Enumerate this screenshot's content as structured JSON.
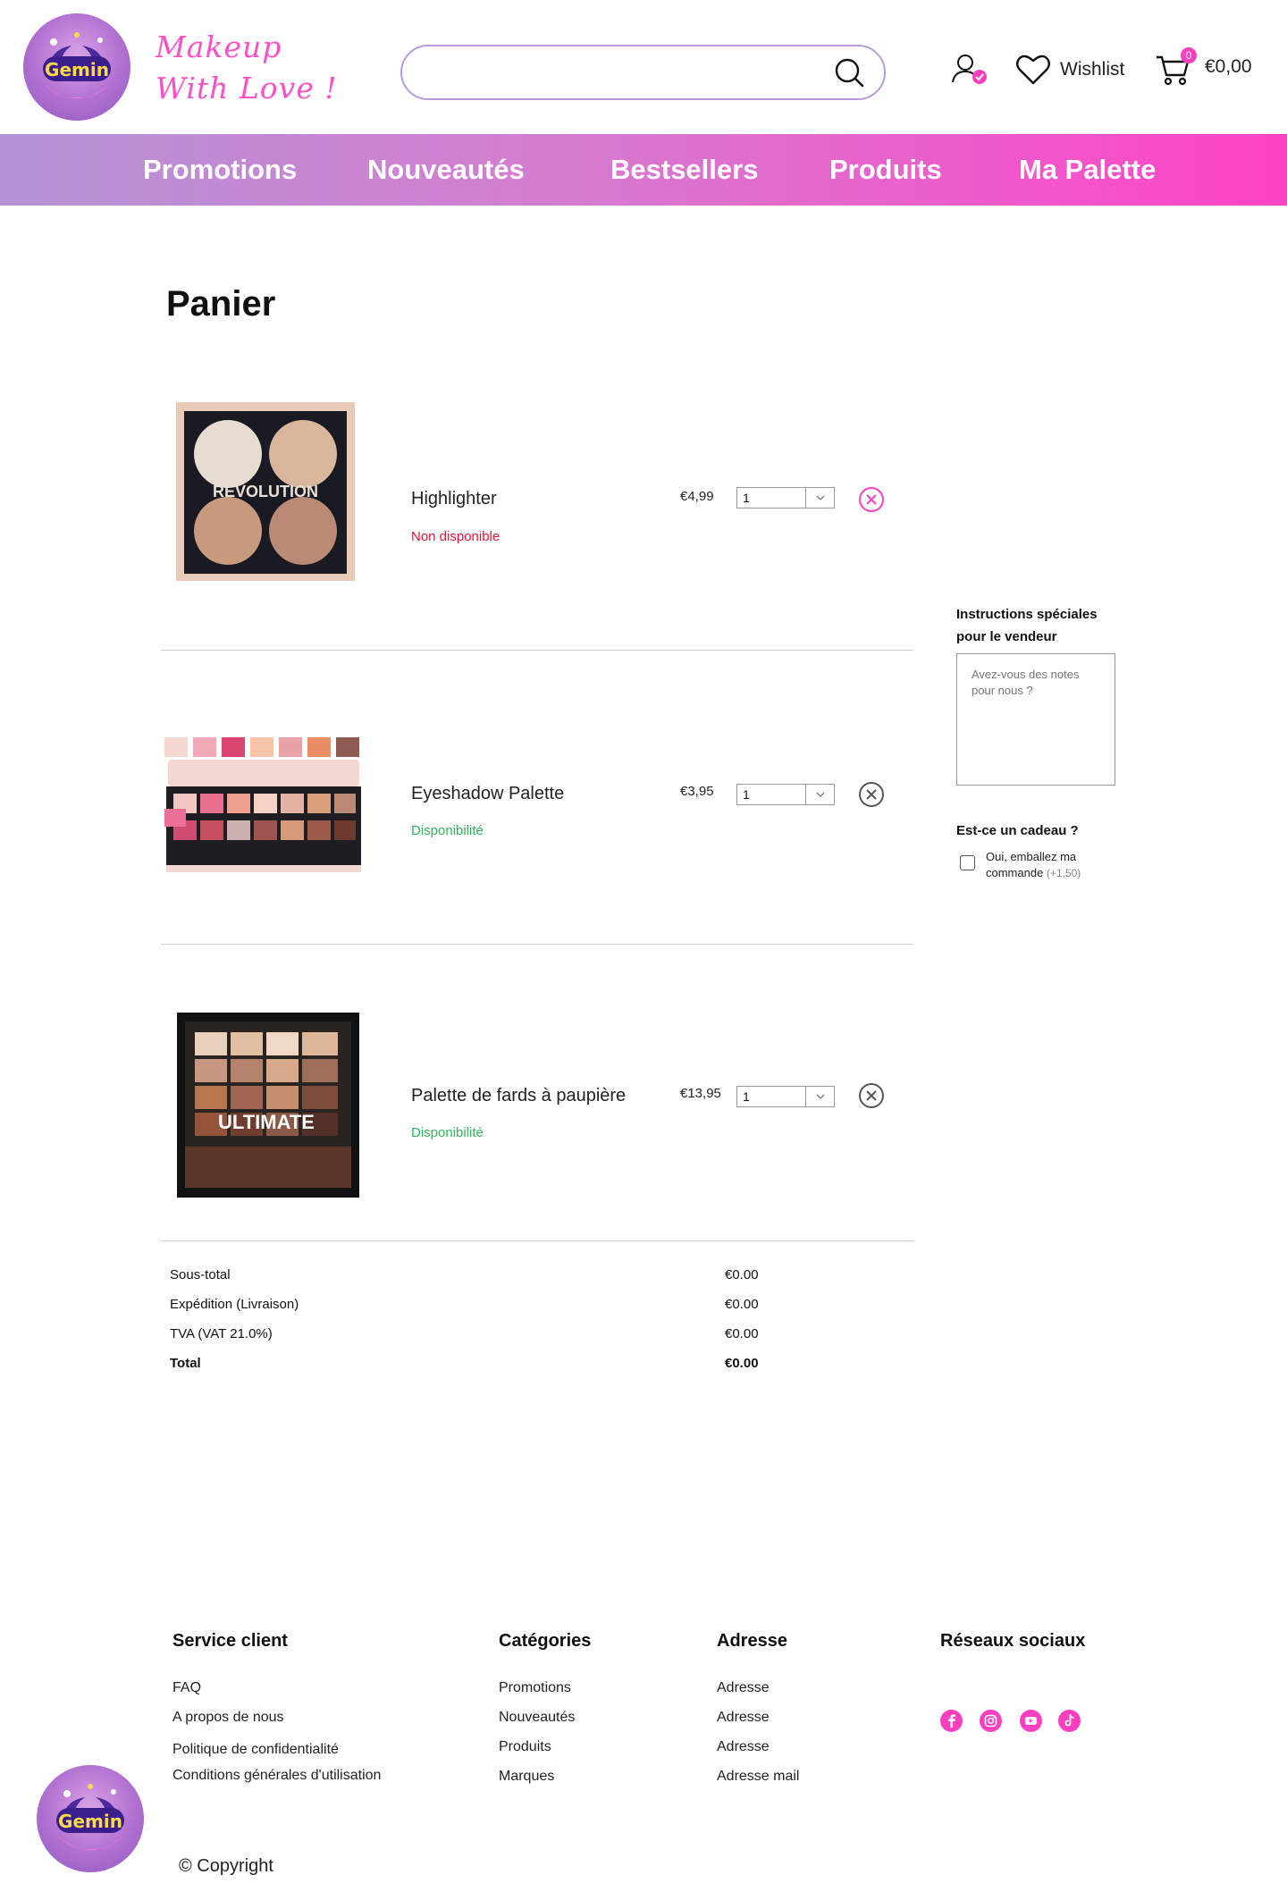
{
  "header": {
    "tagline_line1": "Makeup",
    "tagline_line2": "With Love !",
    "search_placeholder": "",
    "wishlist_label": "Wishlist",
    "cart_count": "0",
    "cart_total": "€0,00",
    "logo_text": "Gemin"
  },
  "nav": {
    "items": [
      {
        "label": "Promotions"
      },
      {
        "label": "Nouveautés"
      },
      {
        "label": "Bestsellers"
      },
      {
        "label": "Produits"
      },
      {
        "label": "Ma Palette"
      }
    ]
  },
  "cart": {
    "title": "Panier",
    "items": [
      {
        "name": "Highlighter",
        "availability": "Non disponible",
        "price": "€4,99",
        "qty": "1",
        "thumb_text": "REVOLUTION"
      },
      {
        "name": "Eyeshadow Palette",
        "availability": "Disponibilité",
        "price": "€3,95",
        "qty": "1"
      },
      {
        "name": "Palette de fards à paupière",
        "availability": "Disponibilité",
        "price": "€13,95",
        "qty": "1",
        "thumb_text": "ULTIMATE"
      }
    ],
    "totals": [
      {
        "label": "Sous-total",
        "value": "€0.00"
      },
      {
        "label": "Expédition (Livraison)",
        "value": "€0.00"
      },
      {
        "label": "TVA (VAT 21.0%)",
        "value": "€0.00"
      },
      {
        "label": "Total",
        "value": "€0.00"
      }
    ]
  },
  "side": {
    "instructions_title_1": "Instructions spéciales",
    "instructions_title_2": "pour le vendeur",
    "notes_placeholder": "Avez-vous des notes pour nous ?",
    "gift_title": "Est-ce un cadeau ?",
    "gift_label_1": "Oui, emballez ma",
    "gift_label_2": "commande",
    "gift_extra": "(+1,50)"
  },
  "footer": {
    "service": {
      "title": "Service client",
      "links": [
        "FAQ",
        "A propos de nous",
        "Politique de confidentialité",
        "Conditions générales d'utilisation"
      ]
    },
    "categories": {
      "title": "Catégories",
      "links": [
        "Promotions",
        "Nouveautés",
        "Produits",
        "Marques"
      ]
    },
    "address": {
      "title": "Adresse",
      "links": [
        "Adresse",
        "Adresse",
        "Adresse",
        "Adresse mail"
      ]
    },
    "social": {
      "title": "Réseaux sociaux",
      "icons": [
        "facebook-icon",
        "instagram-icon",
        "youtube-icon",
        "tiktok-icon"
      ]
    },
    "copyright": "© Copyright"
  },
  "colors": {
    "accent": "#ff3fc0",
    "nav_start": "#b494d6",
    "nav_end": "#ff43c6",
    "out_of_stock": "#e2173b",
    "in_stock": "#31b35c"
  }
}
